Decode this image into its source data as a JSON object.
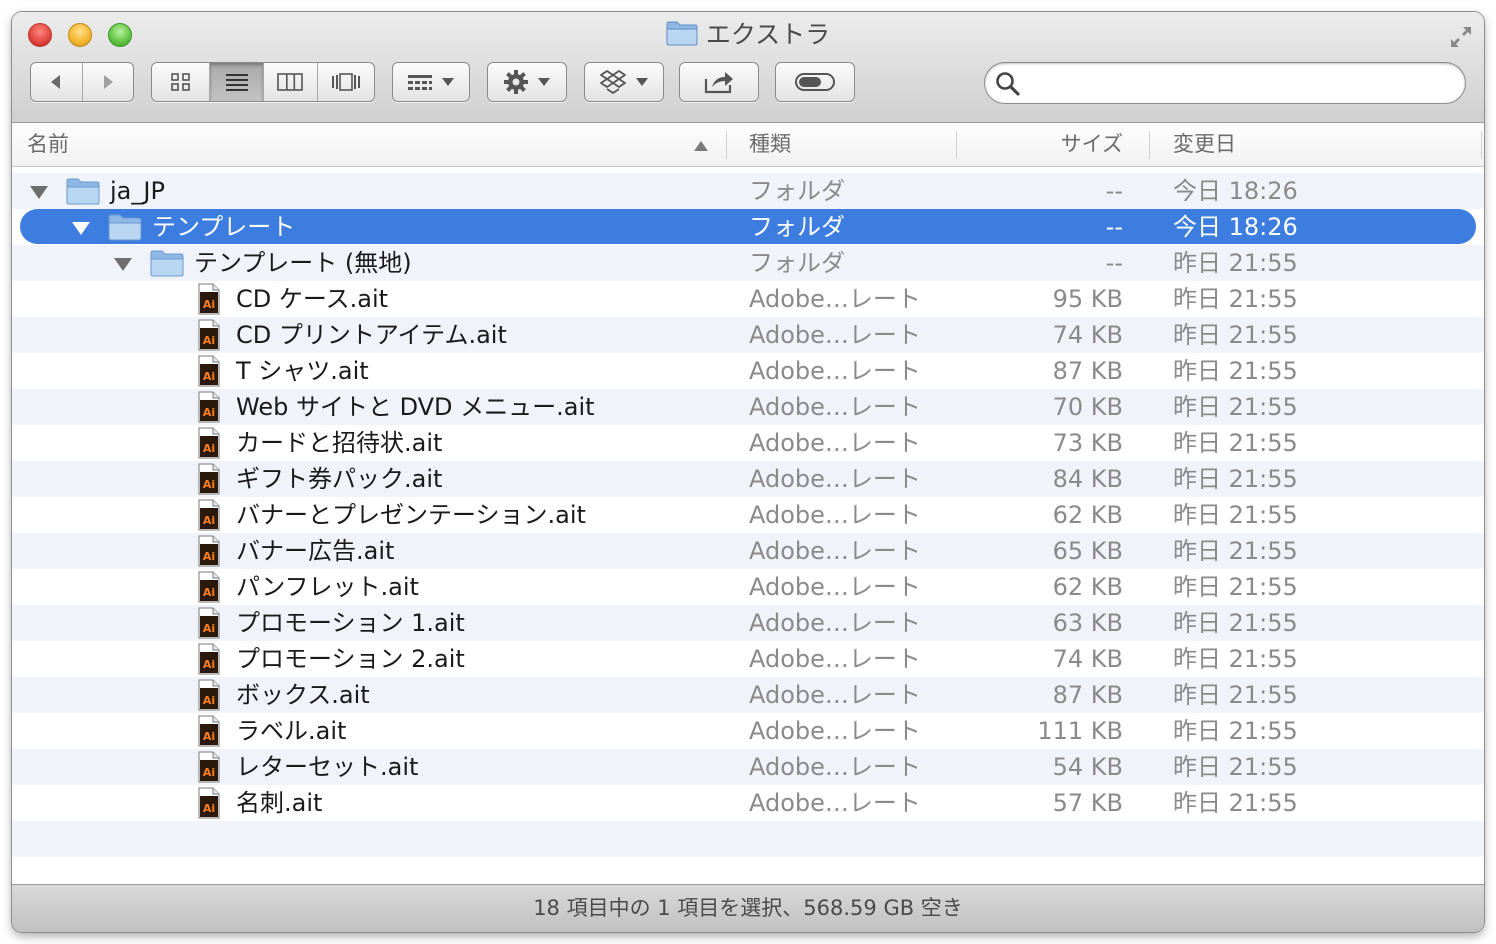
{
  "window": {
    "title": "エクストラ"
  },
  "search": {
    "value": "",
    "placeholder": ""
  },
  "columns": {
    "name": "名前",
    "kind": "種類",
    "size": "サイズ",
    "date": "変更日"
  },
  "rows": [
    {
      "name": "ja_JP",
      "kind": "フォルダ",
      "size": "--",
      "date": "今日 18:26",
      "type": "folder",
      "level": 0,
      "expanded": true,
      "selected": false
    },
    {
      "name": "テンプレート",
      "kind": "フォルダ",
      "size": "--",
      "date": "今日 18:26",
      "type": "folder",
      "level": 1,
      "expanded": true,
      "selected": true
    },
    {
      "name": "テンプレート (無地)",
      "kind": "フォルダ",
      "size": "--",
      "date": "昨日 21:55",
      "type": "folder",
      "level": 2,
      "expanded": true,
      "selected": false
    },
    {
      "name": "CD ケース.ait",
      "kind": "Adobe…レート",
      "size": "95 KB",
      "date": "昨日 21:55",
      "type": "ait",
      "level": 3,
      "selected": false
    },
    {
      "name": "CD プリントアイテム.ait",
      "kind": "Adobe…レート",
      "size": "74 KB",
      "date": "昨日 21:55",
      "type": "ait",
      "level": 3,
      "selected": false
    },
    {
      "name": "T シャツ.ait",
      "kind": "Adobe…レート",
      "size": "87 KB",
      "date": "昨日 21:55",
      "type": "ait",
      "level": 3,
      "selected": false
    },
    {
      "name": "Web サイトと DVD メニュー.ait",
      "kind": "Adobe…レート",
      "size": "70 KB",
      "date": "昨日 21:55",
      "type": "ait",
      "level": 3,
      "selected": false
    },
    {
      "name": "カードと招待状.ait",
      "kind": "Adobe…レート",
      "size": "73 KB",
      "date": "昨日 21:55",
      "type": "ait",
      "level": 3,
      "selected": false
    },
    {
      "name": "ギフト券パック.ait",
      "kind": "Adobe…レート",
      "size": "84 KB",
      "date": "昨日 21:55",
      "type": "ait",
      "level": 3,
      "selected": false
    },
    {
      "name": "バナーとプレゼンテーション.ait",
      "kind": "Adobe…レート",
      "size": "62 KB",
      "date": "昨日 21:55",
      "type": "ait",
      "level": 3,
      "selected": false
    },
    {
      "name": "バナー広告.ait",
      "kind": "Adobe…レート",
      "size": "65 KB",
      "date": "昨日 21:55",
      "type": "ait",
      "level": 3,
      "selected": false
    },
    {
      "name": "パンフレット.ait",
      "kind": "Adobe…レート",
      "size": "62 KB",
      "date": "昨日 21:55",
      "type": "ait",
      "level": 3,
      "selected": false
    },
    {
      "name": "プロモーション 1.ait",
      "kind": "Adobe…レート",
      "size": "63 KB",
      "date": "昨日 21:55",
      "type": "ait",
      "level": 3,
      "selected": false
    },
    {
      "name": "プロモーション 2.ait",
      "kind": "Adobe…レート",
      "size": "74 KB",
      "date": "昨日 21:55",
      "type": "ait",
      "level": 3,
      "selected": false
    },
    {
      "name": "ボックス.ait",
      "kind": "Adobe…レート",
      "size": "87 KB",
      "date": "昨日 21:55",
      "type": "ait",
      "level": 3,
      "selected": false
    },
    {
      "name": "ラベル.ait",
      "kind": "Adobe…レート",
      "size": "111 KB",
      "date": "昨日 21:55",
      "type": "ait",
      "level": 3,
      "selected": false
    },
    {
      "name": "レターセット.ait",
      "kind": "Adobe…レート",
      "size": "54 KB",
      "date": "昨日 21:55",
      "type": "ait",
      "level": 3,
      "selected": false
    },
    {
      "name": "名刺.ait",
      "kind": "Adobe…レート",
      "size": "57 KB",
      "date": "昨日 21:55",
      "type": "ait",
      "level": 3,
      "selected": false
    }
  ],
  "icons": {
    "app_file_icon_text": "Ai",
    "app_file_icon_color": "#ff7f18",
    "app_file_icon_bg": "#2b1a0b"
  },
  "colors": {
    "selection": "#3d7de0",
    "alt_row": "#f0f4fa",
    "folder": "#a9c9ec"
  },
  "status": {
    "text": "18 項目中の 1 項目を選択、568.59 GB 空き"
  }
}
